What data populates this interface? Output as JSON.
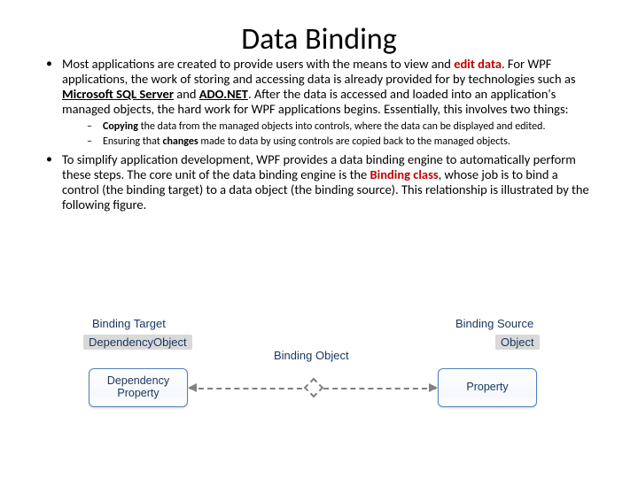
{
  "title": "Data Binding",
  "bullets": {
    "b1_pre": "Most applications are created to provide users with the means to view and ",
    "b1_edit": "edit data",
    "b1_mid1": ". For WPF applications, the work of storing and accessing data is already provided for by technologies such as ",
    "b1_sql": "Microsoft SQL Server",
    "b1_and": " and ",
    "b1_ado": "ADO.NET",
    "b1_tail": ". After the data is accessed and loaded into an application's managed objects, the hard work for WPF applications begins. Essentially, this involves two things:",
    "sub1_copy": "Copying",
    "sub1_rest": " the data from the managed objects into controls, where the data can be displayed and edited.",
    "sub2_pre": "Ensuring that ",
    "sub2_changes": "changes",
    "sub2_rest": " made to data by using controls are copied back to the managed objects.",
    "b2_pre": "To simplify application development, WPF provides a data binding engine to automatically perform these steps. The core unit of the data binding engine is the ",
    "b2_binding": "Binding class",
    "b2_rest": ", whose job is to bind a control (the binding target) to a data object (the binding source). This relationship is illustrated by the following figure."
  },
  "diagram": {
    "binding_target": "Binding Target",
    "binding_source": "Binding Source",
    "dependency_object": "DependencyObject",
    "object": "Object",
    "binding_object": "Binding Object",
    "dependency_property": "Dependency Property",
    "property": "Property"
  }
}
